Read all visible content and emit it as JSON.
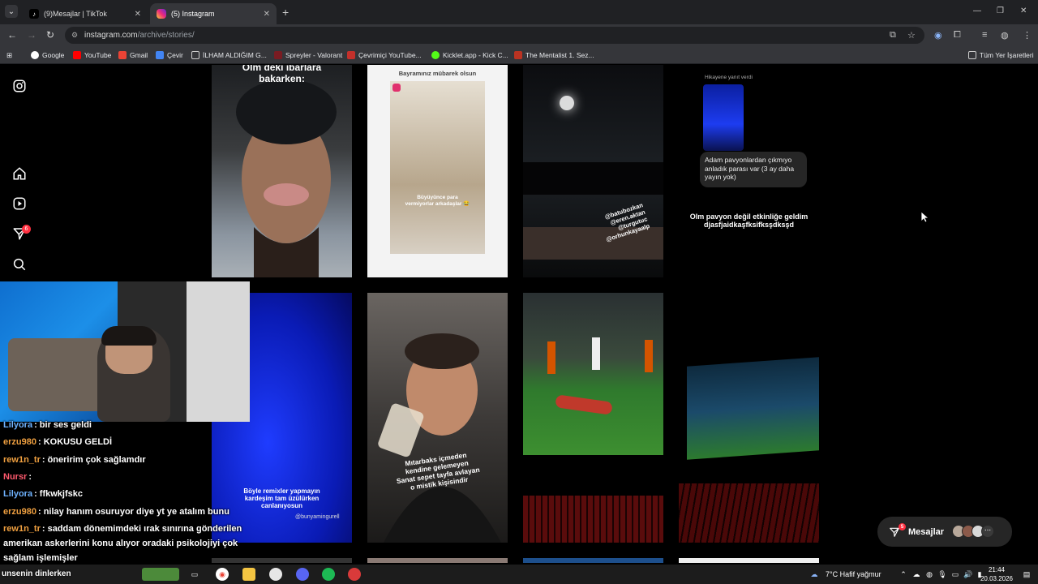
{
  "browser": {
    "tabs": [
      {
        "label": "(9)Mesajlar | TikTok",
        "active": false
      },
      {
        "label": "(5) Instagram",
        "active": true
      }
    ],
    "url_host": "instagram.com",
    "url_path": "/archive/stories/",
    "bookmarks": [
      "Google",
      "YouTube",
      "Gmail",
      "Çevir",
      "İLHAM ALDIĞIM G...",
      "Spreyler - Valorant",
      "Çevrimiçi YouTube...",
      "Kicklet.app - Kick C...",
      "The Mentalist 1. Sez..."
    ],
    "all_bookmarks": "Tüm Yer İşaretleri"
  },
  "sidebar": {
    "notifications_badge": "6"
  },
  "stories": [
    {
      "caption_top": "Olm deki ibarlara\nbakarken:"
    },
    {
      "caption_top": "Bayramınız mübarek olsun",
      "caption_mid": "Büyüyünce para\nvermiyorlar arkadaşlar 😂"
    },
    {
      "tags": "@batubozkan\n@eren.aktan\n@turgutuc\n@orhunkayaalp"
    },
    {
      "header": "Hikayene yanıt verdi",
      "reply": "Adam pavyonlardan çıkmıyo anladık parası var (3 ay daha yayın yok)",
      "caption": "Olm pavyon değil etkinliğe geldim djasfjaidkaşfksifksşdksşd"
    },
    {
      "caption": "Böyle remixler yapmayın\nkardeşim tam üzülürken\ncanlanıyosun",
      "credit": "@bunyamingurell"
    },
    {
      "caption": "Mıtarbaks içmeden\nkendine gelemeyen\nSanat sepet tayfa avlayan\no mistik kişisindir"
    },
    {},
    {}
  ],
  "chat": [
    {
      "user": "Lilyora",
      "color": "#6fb3ff",
      "text": ": bir ses geldi"
    },
    {
      "user": "erzu980",
      "color": "#f0a040",
      "text": ": KOKUSU GELDİ"
    },
    {
      "user": "rew1n_tr",
      "color": "#f0a040",
      "text": ": öneririm çok sağlamdır"
    },
    {
      "user": "Nursr",
      "color": "#ff5a6e",
      "text": ":"
    },
    {
      "user": "Lilyora",
      "color": "#6fb3ff",
      "text": ": ffkwkjfskc"
    },
    {
      "user": "erzu980",
      "color": "#f0a040",
      "text": ": nilay hanım osuruyor diye yt ye atalım bunu"
    },
    {
      "user": "rew1n_tr",
      "color": "#f0a040",
      "text": ": saddam dönemimdeki ırak sınırına gönderilen"
    },
    {
      "user": "",
      "color": "#fff",
      "text": "amerikan askerlerini konu alıyor oradaki psikolojiyi çok"
    },
    {
      "user": "",
      "color": "#fff",
      "text": "sağlam işlemişler"
    }
  ],
  "messages": {
    "label": "Mesajlar",
    "badge": "5"
  },
  "taskbar": {
    "now_playing": "unsenin dinlerken",
    "weather": "7°C  Hafif yağmur",
    "time": "21:44",
    "date": "20.03.2026"
  }
}
